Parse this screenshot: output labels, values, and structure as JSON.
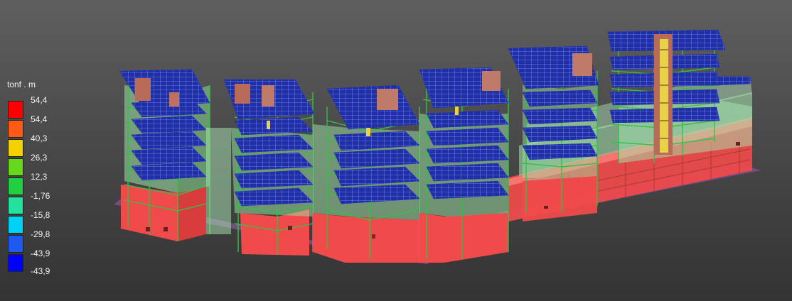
{
  "legend": {
    "unit": "tonf . m",
    "labels": [
      "54,4",
      "54,4",
      "40,3",
      "26,3",
      "12,3",
      "-1,76",
      "-15,8",
      "-29,8",
      "-43,9",
      "-43,9"
    ],
    "colors": [
      "#ff0000",
      "#ff5a14",
      "#f5d000",
      "#66d81a",
      "#20d040",
      "#22e39e",
      "#00d2f5",
      "#1e5af0",
      "#0000ff"
    ]
  },
  "model": {
    "colors": {
      "slab_blue": "#1f2fa8",
      "grid_light": "#7a8ce0",
      "frame_green": "#3fd04f",
      "wall_red": "#f04a4a",
      "wall_light": "#ff7a74",
      "wall_green": "#8ee09a",
      "base_purple": "#7a4e86",
      "stair_yellow": "#e8d24a",
      "core_brown": "#b86b58"
    }
  }
}
